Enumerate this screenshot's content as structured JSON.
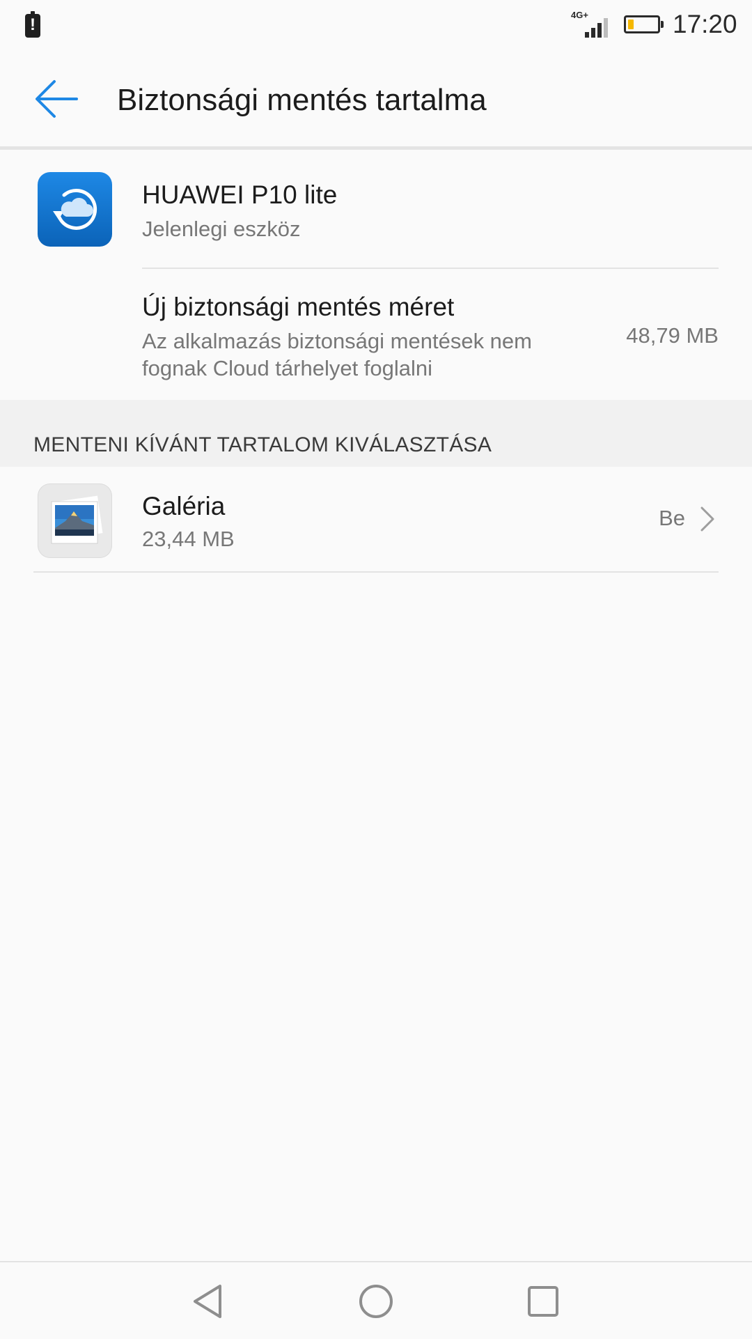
{
  "status_bar": {
    "network_label": "4G+",
    "time": "17:20",
    "battery_level": 0.2,
    "battery_color": "#f5b800"
  },
  "header": {
    "title": "Biztonsági mentés tartalma",
    "back_icon": "arrow-left-icon",
    "accent": "#1e88e5"
  },
  "device": {
    "name": "HUAWEI P10 lite",
    "subtitle": "Jelenlegi eszköz",
    "icon": "backup-cloud-icon"
  },
  "backup_size": {
    "title": "Új biztonsági mentés méret",
    "description": "Az alkalmazás biztonsági mentések nem fognak Cloud tárhelyet foglalni",
    "value": "48,79 MB"
  },
  "section": {
    "label": "MENTENI KÍVÁNT TARTALOM KIVÁLASZTÁSA"
  },
  "items": [
    {
      "title": "Galéria",
      "size": "23,44 MB",
      "state": "Be",
      "icon": "gallery-icon"
    }
  ],
  "nav": {
    "back": "nav-back-icon",
    "home": "nav-home-icon",
    "recents": "nav-recents-icon"
  }
}
